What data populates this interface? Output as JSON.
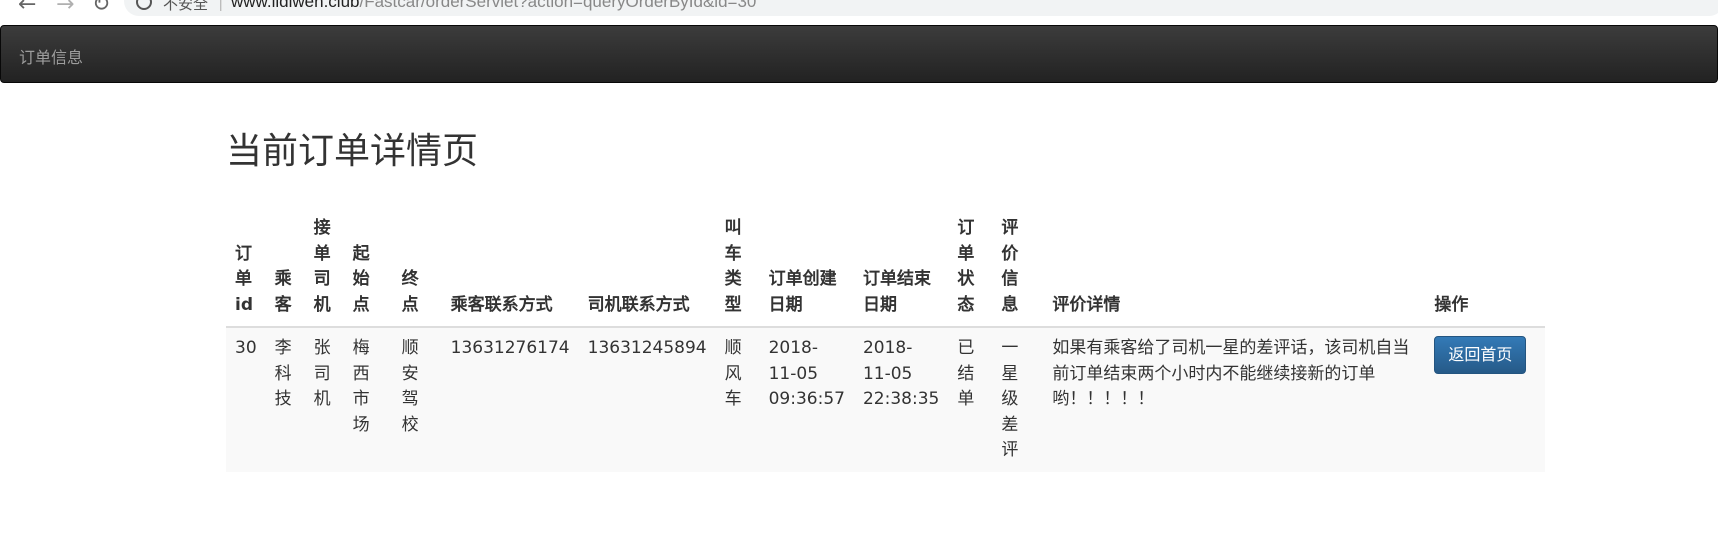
{
  "browser": {
    "security_label": "不安全",
    "url_host": "www.lidiwen.club",
    "url_path": "/Fastcar/orderServlet?action=queryOrderById&id=30"
  },
  "navbar": {
    "brand": "订单信息"
  },
  "page": {
    "title": "当前订单详情页"
  },
  "table": {
    "headers": {
      "id": "订单id",
      "passenger": "乘客",
      "driver": "接单司机",
      "start": "起始点",
      "end": "终点",
      "passenger_phone": "乘客联系方式",
      "driver_phone": "司机联系方式",
      "car_type": "叫车类型",
      "created": "订单创建日期",
      "finished": "订单结束日期",
      "status": "订单状态",
      "evaluation": "评价信息",
      "evaluation_detail": "评价详情",
      "operation": "操作"
    },
    "row": {
      "id": "30",
      "passenger": "李科技",
      "driver": "张司机",
      "start": "梅西市场",
      "end": "顺安驾校",
      "passenger_phone": "13631276174",
      "driver_phone": "13631245894",
      "car_type": "顺风车",
      "created": "2018-11-05 09:36:57",
      "finished": "2018-11-05 22:38:35",
      "status": "已结单",
      "evaluation": "一星级差评",
      "evaluation_detail": "如果有乘客给了司机一星的差评话，该司机自当前订单结束两个小时内不能继续接新的订单哟！！！！！",
      "back_button": "返回首页"
    }
  }
}
